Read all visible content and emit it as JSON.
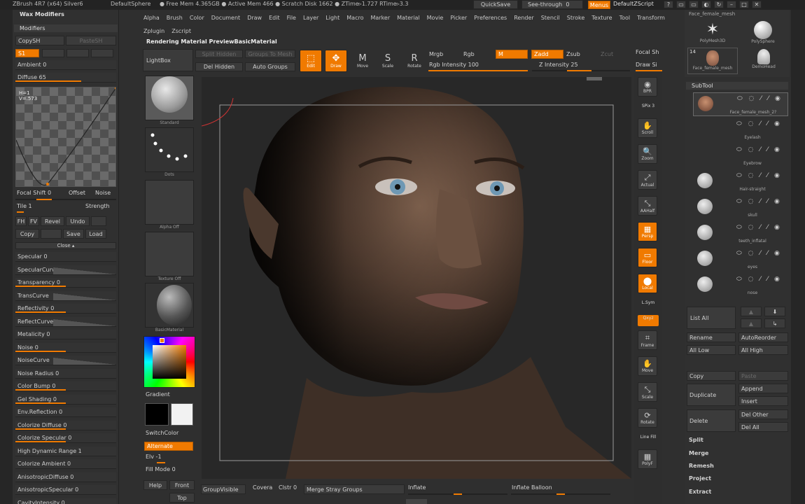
{
  "titlebar": {
    "app": "ZBrush 4R7 (x64) Silver6",
    "doc": "DefaultSphere",
    "mem": "● Free Mem 4.365GB ● Active Mem 466 ● Scratch Disk 1662 ● ZTime▹1.727 RTime▹3.3",
    "quicksave": "QuickSave",
    "seethrough": "See-through",
    "seethrough_val": "0",
    "menus": "Menus",
    "script": "DefaultZScript"
  },
  "menubar": {
    "row1": [
      "Alpha",
      "Brush",
      "Color",
      "Document",
      "Draw",
      "Edit",
      "File",
      "Layer",
      "Light",
      "Macro",
      "Marker",
      "Material",
      "Movie",
      "Picker",
      "Preferences",
      "Render",
      "Stencil",
      "Stroke",
      "Texture",
      "Tool",
      "Transform"
    ],
    "row2": [
      "Zplugin",
      "Zscript"
    ]
  },
  "status": "Rendering Material PreviewBasicMaterial",
  "left_panel": {
    "header": "Wax Modifiers",
    "section": "Modifiers",
    "copysh": "CopySH",
    "pastesh": "PasteSH",
    "s1": "S1",
    "ambient": "Ambient 0",
    "diffuse": "Diffuse 65",
    "curve_readout": [
      "H=1",
      "V=.573"
    ],
    "focal_shift": "Focal Shift 0",
    "offset": "Offset",
    "noise": "Noise",
    "tile": "Tile 1",
    "strength": "Strength",
    "btns_row1": [
      "FH",
      "FV",
      "Revel",
      "Undo"
    ],
    "btns_row2": [
      "Copy",
      "Save",
      "Load"
    ],
    "close": "Close ▴",
    "sliders": [
      {
        "label": "Specular 0",
        "fill": 0
      },
      {
        "label": "SpecularCurve",
        "fill": 0
      },
      {
        "label": "Transparency 0",
        "fill": 0.5
      },
      {
        "label": "TransCurve",
        "fill": 0
      },
      {
        "label": "Reflectivity 0",
        "fill": 0.5
      },
      {
        "label": "ReflectCurve",
        "fill": 0
      },
      {
        "label": "Metalicity 0",
        "fill": 0
      },
      {
        "label": "Noise 0",
        "fill": 0.5
      },
      {
        "label": "NoiseCurve",
        "fill": 0
      },
      {
        "label": "Noise Radius 0",
        "fill": 0
      },
      {
        "label": "Color Bump 0",
        "fill": 0.5
      },
      {
        "label": "Gel Shading 0",
        "fill": 0.5
      },
      {
        "label": "Env.Reflection 0",
        "fill": 0
      },
      {
        "label": "Colorize Diffuse 0",
        "fill": 0.5
      },
      {
        "label": "Colorize Specular 0",
        "fill": 0.5
      },
      {
        "label": "High Dynamic Range 1",
        "fill": 0
      },
      {
        "label": "Colorize Ambient 0",
        "fill": 0
      },
      {
        "label": "AnisotropicDiffuse 0",
        "fill": 0
      },
      {
        "label": "AnisotropicSpecular 0",
        "fill": 0
      },
      {
        "label": "CavityIntensity 0",
        "fill": 0
      }
    ]
  },
  "shelf": {
    "lightbox": "LightBox",
    "thumbs": [
      "Standard",
      "Dots",
      "Alpha Off",
      "Texture Off",
      "BasicMaterial"
    ],
    "gradient": "Gradient",
    "switchcolor": "SwitchColor",
    "alternate": "Alternate",
    "elv": "Elv -1",
    "fill_mode": "Fill Mode 0",
    "help": "Help",
    "front": "Front",
    "top": "Top",
    "main_color": "#000000",
    "secondary_color": "#f2f2f2"
  },
  "top_toolbar": {
    "split_hidden": "Split Hidden",
    "groups_to_mesh": "Groups To Mesh",
    "del_hidden": "Del Hidden",
    "auto_groups": "Auto Groups",
    "edit": "Edit",
    "draw": "Draw",
    "move": "Move",
    "scale": "Scale",
    "rotate": "Rotate",
    "mrgb": "Mrgb",
    "rgb": "Rgb",
    "m": "M",
    "zadd": "Zadd",
    "zsub": "Zsub",
    "zcut": "Zcut",
    "rgb_intensity": "Rgb Intensity 100",
    "z_intensity": "Z Intensity 25",
    "focal_shift": "Focal Sh",
    "draw_size": "Draw Si"
  },
  "bottom_toolbar": {
    "groupvisible": "GroupVisible",
    "coverage": "Covera",
    "clstr": "Clstr 0",
    "merge_stray": "Merge Stray Groups",
    "inflate": "Inflate",
    "inflate_balloon": "Inflate Balloon"
  },
  "right_shelf": [
    {
      "name": "bpr",
      "label": "BPR",
      "active": false
    },
    {
      "name": "spix",
      "label": "SPix 3",
      "active": false
    },
    {
      "name": "scroll",
      "label": "Scroll",
      "active": false
    },
    {
      "name": "zoom",
      "label": "Zoom",
      "active": false
    },
    {
      "name": "actual",
      "label": "Actual",
      "active": false
    },
    {
      "name": "aahalf",
      "label": "AAHalf",
      "active": false
    },
    {
      "name": "persp",
      "label": "Persp",
      "active": true
    },
    {
      "name": "floor",
      "label": "Floor",
      "active": true
    },
    {
      "name": "local",
      "label": "Local",
      "active": true
    },
    {
      "name": "lsym",
      "label": "L.Sym",
      "active": false
    },
    {
      "name": "xyz",
      "label": "Qxyz",
      "active": true
    },
    {
      "name": "frame",
      "label": "Frame",
      "active": false
    },
    {
      "name": "move",
      "label": "Move",
      "active": false
    },
    {
      "name": "scale",
      "label": "Scale",
      "active": false
    },
    {
      "name": "rotate",
      "label": "Rotate",
      "active": false
    },
    {
      "name": "linefill",
      "label": "Line Fill",
      "active": false
    },
    {
      "name": "polyf",
      "label": "PolyF",
      "active": false
    }
  ],
  "tool_palette": {
    "top_name": "Face_female_mesh",
    "items": [
      {
        "label": "PolyMesh3D"
      },
      {
        "label": "PolySphere"
      },
      {
        "label": "Face_female_mesh"
      },
      {
        "label": "DemoHead"
      }
    ],
    "count": "14"
  },
  "subtool": {
    "header": "SubTool",
    "items": [
      "Face_female_mesh_2?",
      "Eyelash",
      "Eyebrow",
      "Hair-straight",
      "skull",
      "teeth_inflatal",
      "eyes",
      "nose"
    ],
    "list_all": "List All",
    "rename": "Rename",
    "autoreorder": "AutoReorder",
    "all_low": "All Low",
    "all_high": "All High",
    "copy": "Copy",
    "paste": "Paste",
    "duplicate": "Duplicate",
    "append": "Append",
    "insert": "Insert",
    "delete": "Delete",
    "del_other": "Del Other",
    "del_all": "Del All",
    "split": "Split",
    "merge": "Merge",
    "remesh": "Remesh",
    "project": "Project",
    "extract": "Extract"
  },
  "colors": {
    "accent": "#f07a00",
    "panel": "#303030",
    "canvas": "#2a2a2a"
  }
}
